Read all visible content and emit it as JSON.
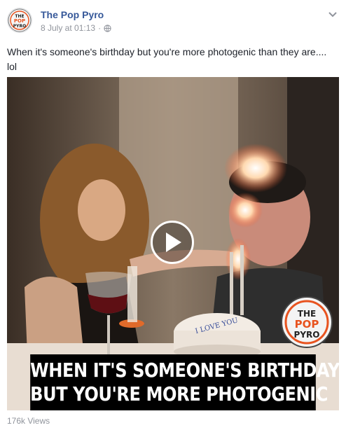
{
  "post": {
    "page_name": "The Pop Pyro",
    "timestamp": "8 July at 01:13",
    "privacy_icon": "globe-icon",
    "menu_icon": "chevron-down-icon",
    "caption": "When it's someone's birthday but you're more photogenic than they are.... lol",
    "avatar_logo_text": [
      "THE",
      "POP",
      "PYRO"
    ],
    "video": {
      "caption_lines": [
        "WHEN IT'S SOMEONE'S BIRTHDAY",
        "BUT YOU'RE MORE PHOTOGENIC"
      ],
      "cake_text": "I LOVE YOU",
      "watermark_text": [
        "THE",
        "POP",
        "PYRO"
      ],
      "play_icon": "play-icon"
    },
    "views": "176k Views"
  },
  "colors": {
    "link": "#365899",
    "meta": "#90949c",
    "logo_orange": "#e8531f",
    "caption_bg": "#000000"
  }
}
